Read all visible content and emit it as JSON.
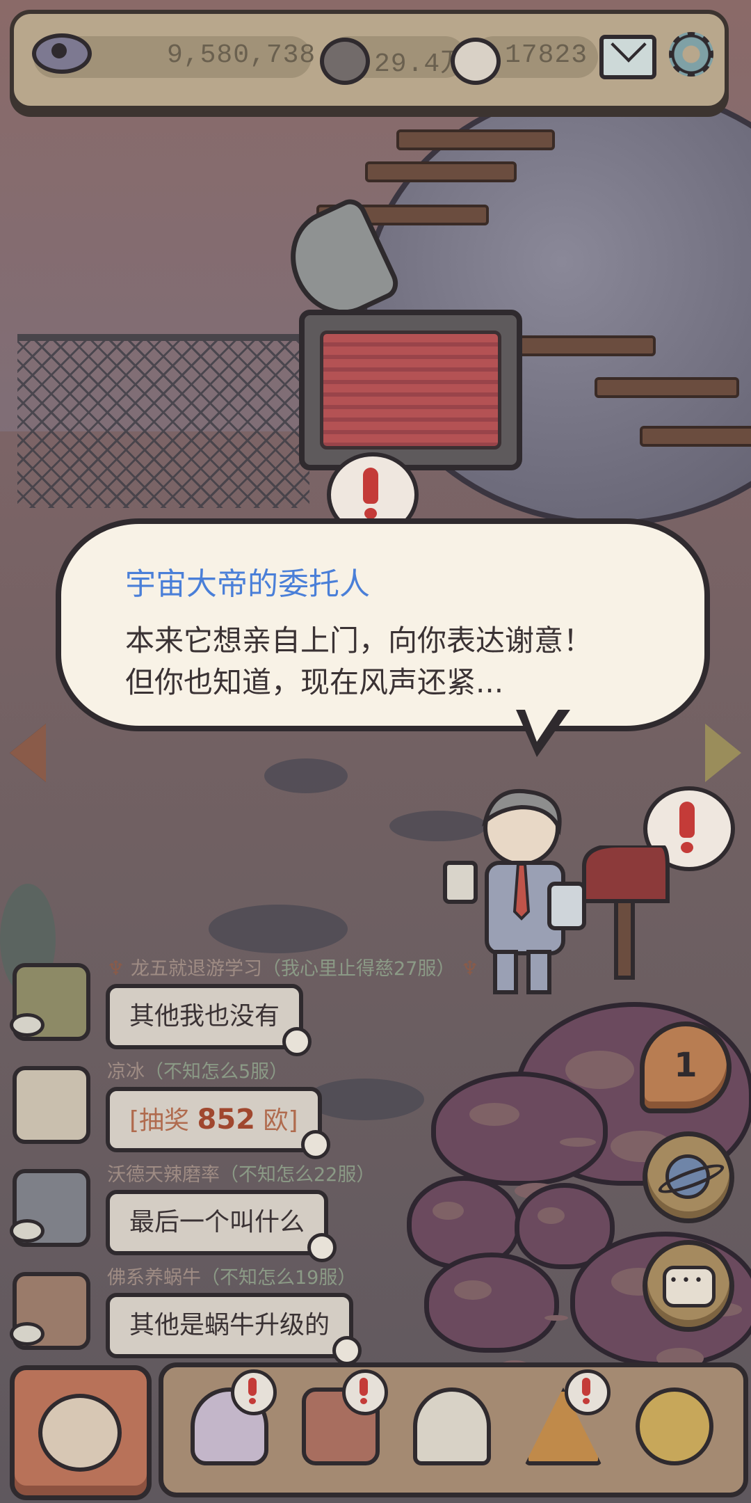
{
  "stats": {
    "views": "9,580,738",
    "comments": "29.4万",
    "replies": "17823"
  },
  "dialog": {
    "speaker": "宇宙大帝的委托人",
    "line1": "本来它想亲自上门，向你表达谢意！",
    "line2": "但你也知道，现在风声还紧..."
  },
  "chat": [
    {
      "name": "龙五就退游学习",
      "server": "（我心里止得慈27服）",
      "text": "其他我也没有"
    },
    {
      "name": "凉冰",
      "server": "（不知怎么5服）",
      "lottery_prefix": "[抽奖 ",
      "lottery_amount": "852",
      "lottery_suffix": " 欧]"
    },
    {
      "name": "沃德天辣磨率",
      "server": "（不知怎么22服）",
      "text": "最后一个叫什么"
    },
    {
      "name": "佛系养蜗牛",
      "server": "（不知怎么19服）",
      "text": "其他是蜗牛升级的"
    }
  ],
  "side_buttons": {
    "badge_count": "1"
  },
  "icons": {
    "top": [
      "eye-icon",
      "comment-bubble-icon",
      "reply-bubble-icon",
      "mail-icon",
      "gear-icon"
    ],
    "bottom": [
      "horn-icon",
      "snail-icon",
      "backpack-icon",
      "statue-icon",
      "pyramid-eye-icon",
      "key-icon"
    ],
    "right": [
      "badge-1-icon",
      "planet-icon",
      "chat-icon"
    ]
  },
  "colors": {
    "speaker_name": "#4a7fd8",
    "alert_red": "#c43b38",
    "lottery": "#b06b4e"
  }
}
